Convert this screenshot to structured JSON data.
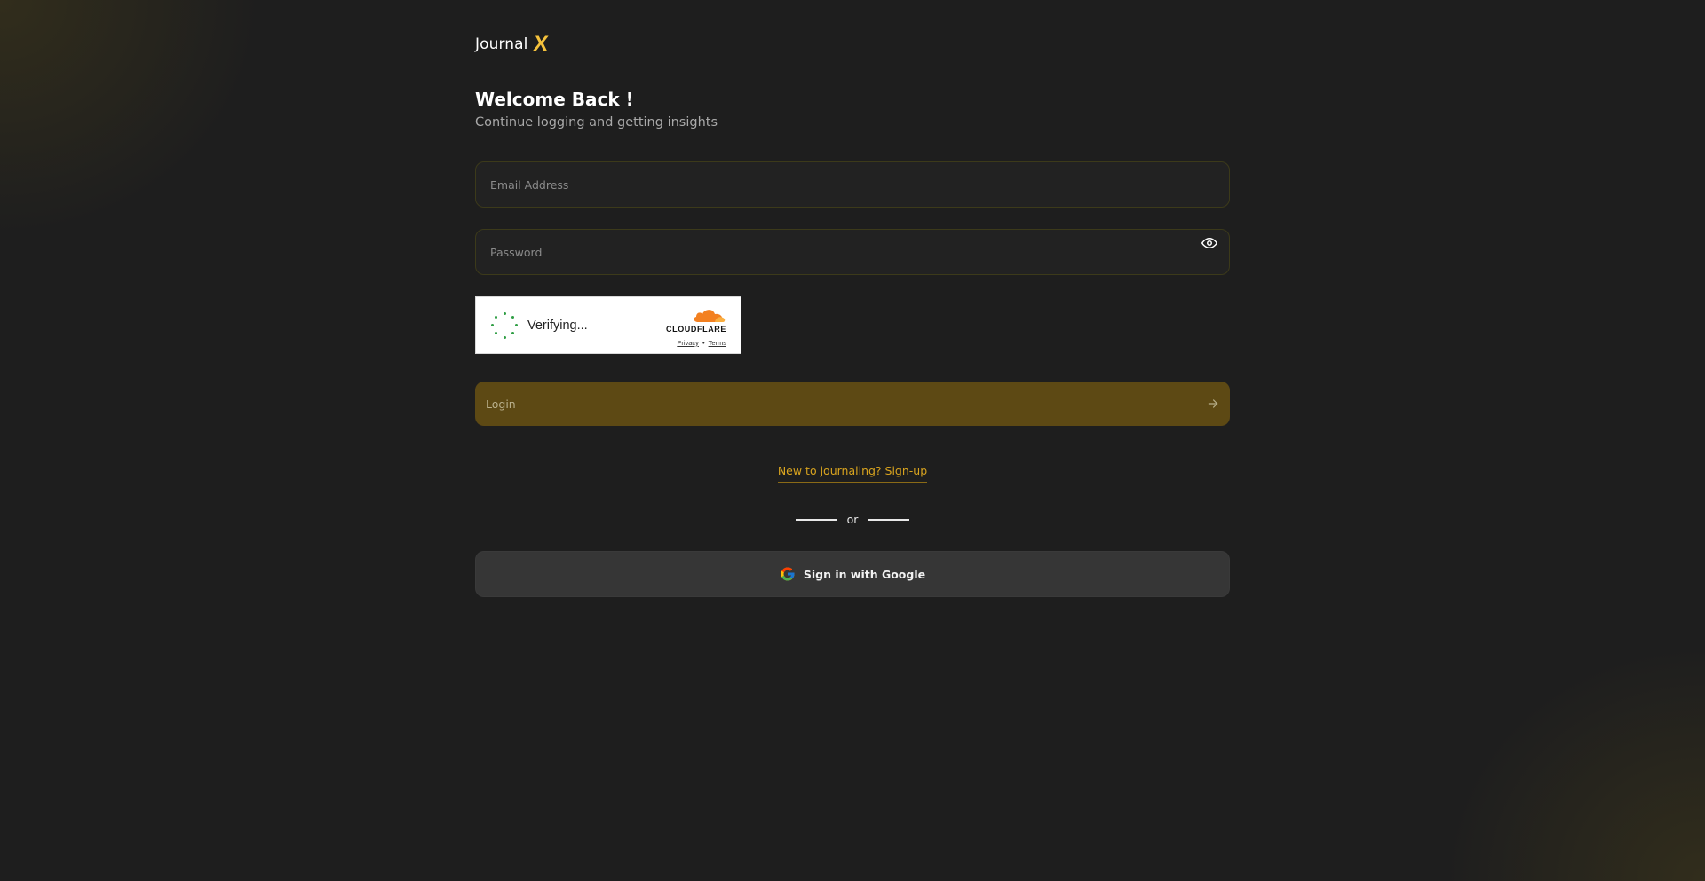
{
  "brand": {
    "name": "Journal",
    "mark": "X",
    "accent_color": "#f5c23c"
  },
  "header": {
    "title": "Welcome Back !",
    "subtitle": "Continue logging and getting insights"
  },
  "form": {
    "email": {
      "placeholder": "Email Address",
      "value": ""
    },
    "password": {
      "placeholder": "Password",
      "value": "",
      "toggle_icon": "eye-icon"
    },
    "login_label": "Login",
    "login_icon": "arrow-right-icon",
    "login_color": "#5d4914"
  },
  "captcha": {
    "status": "Verifying...",
    "provider": "CLOUDFLARE",
    "privacy_label": "Privacy",
    "separator": "•",
    "terms_label": "Terms",
    "spinner_color": "#2f9e44"
  },
  "signup": {
    "label": "New to journaling? Sign-up",
    "color": "#d9a41f"
  },
  "divider": {
    "label": "or"
  },
  "google": {
    "label": "Sign in with Google",
    "icon": "google-icon"
  }
}
